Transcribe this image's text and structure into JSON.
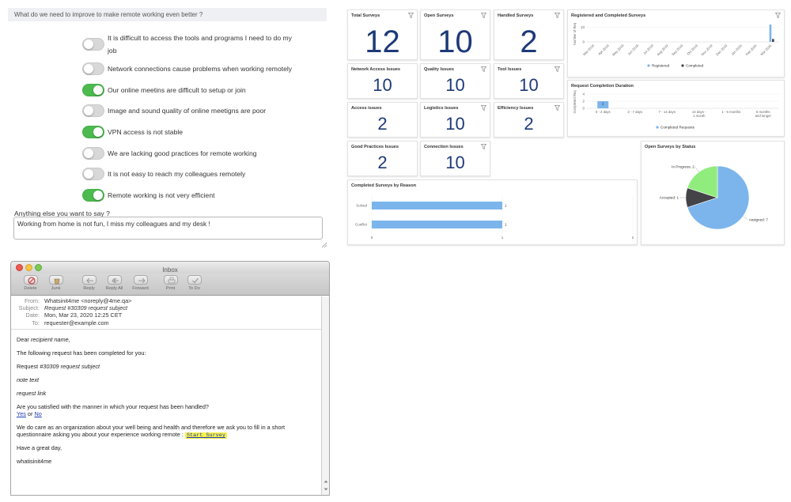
{
  "survey": {
    "question": "What do we need to improve to make remote working even better ?",
    "options": [
      {
        "label": "It is difficult to access the tools and programs I need to do my job",
        "on": false
      },
      {
        "label": "Network connections cause problems when working remotely",
        "on": false
      },
      {
        "label": "Our online meetins are difficult to setup or join",
        "on": true
      },
      {
        "label": "Image and sound quality of online meetigns are poor",
        "on": false
      },
      {
        "label": "VPN access is not stable",
        "on": true
      },
      {
        "label": "We are lacking good practices for remote working",
        "on": false
      },
      {
        "label": "It is not easy to reach my colleagues remotely",
        "on": false
      },
      {
        "label": "Remote working is not very efficient",
        "on": true
      }
    ],
    "anything_label": "Anything else you want to say ?",
    "anything_value": "Working from home is not fun, I miss my colleagues and my desk !"
  },
  "dashboard": {
    "kpis": [
      {
        "title": "Total Surveys",
        "value": "12"
      },
      {
        "title": "Open Surveys",
        "value": "10"
      },
      {
        "title": "Handled Surveys",
        "value": "2"
      },
      {
        "title": "Network Access Issues",
        "value": "10"
      },
      {
        "title": "Quality Issues",
        "value": "10"
      },
      {
        "title": "Tool Issues",
        "value": "10"
      },
      {
        "title": "Access issues",
        "value": "2"
      },
      {
        "title": "Logistics Issues",
        "value": "10"
      },
      {
        "title": "Efficiency Issues",
        "value": "2"
      },
      {
        "title": "Good Practices Issues",
        "value": "2"
      },
      {
        "title": "Connection Issues",
        "value": "10"
      }
    ],
    "colors": {
      "number": "#1d3a78",
      "bar": "#7cb5ec",
      "pie_assigned": "#7cb5ec",
      "pie_accepted": "#434348",
      "pie_inprogress": "#90ed7d"
    }
  },
  "chart_data": [
    {
      "type": "bar",
      "title": "Registered and Completed Surveys",
      "ylabel": "Number of Req",
      "categories": [
        "Mar 2019",
        "Apr 2019",
        "May 2019",
        "Jun 2019",
        "Jul 2019",
        "Aug 2019",
        "Sep 2019",
        "Oct 2019",
        "Nov 2019",
        "Dec 2019",
        "Jan 2020",
        "Feb 2020",
        "Mar 2020"
      ],
      "series": [
        {
          "name": "Registered",
          "values": [
            0,
            0,
            0,
            0,
            0,
            0,
            0,
            0,
            0,
            0,
            0,
            0,
            12
          ]
        },
        {
          "name": "Completed",
          "values": [
            0,
            0,
            0,
            0,
            0,
            0,
            0,
            0,
            0,
            0,
            0,
            0,
            2
          ]
        }
      ],
      "yticks": [
        "10",
        "0"
      ],
      "ylim": [
        0,
        12
      ],
      "legend": "bottom"
    },
    {
      "type": "bar",
      "title": "Request Completion Duration",
      "ylabel": "Completed Req",
      "categories": [
        "0 - 2 days",
        "2 - 7 days",
        "7 - 14 days",
        "14 days - 1 month",
        "1 - 6 months",
        "6 months and longer"
      ],
      "series": [
        {
          "name": "Completed Requests",
          "values": [
            2,
            0,
            0,
            0,
            0,
            0
          ]
        }
      ],
      "data_labels": [
        "2"
      ],
      "yticks": [
        "4",
        "2",
        "0"
      ],
      "ylim": [
        0,
        4
      ],
      "legend": "bottom"
    },
    {
      "type": "bar",
      "orientation": "horizontal",
      "title": "Completed Surveys by Reason",
      "categories": [
        "Solved",
        "Conflict"
      ],
      "values": [
        1,
        1
      ],
      "data_labels": [
        "1",
        "1"
      ],
      "xticks": [
        "0",
        "1",
        "2"
      ],
      "xlim": [
        0,
        2
      ]
    },
    {
      "type": "pie",
      "title": "Open Surveys by Status",
      "labels": [
        "Assigned",
        "Accepted",
        "In Progress"
      ],
      "values": [
        7,
        1,
        2
      ],
      "data_labels": [
        "Assigned: 7",
        "Accepted: 1",
        "In Progress: 2"
      ]
    }
  ],
  "mail": {
    "window_title": "Inbox",
    "toolbar": [
      {
        "label": "Delete",
        "icon": "delete-icon"
      },
      {
        "label": "Junk",
        "icon": "junk-icon"
      },
      {
        "label": "Reply",
        "icon": "reply-icon"
      },
      {
        "label": "Reply All",
        "icon": "reply-all-icon"
      },
      {
        "label": "Forward",
        "icon": "forward-icon"
      },
      {
        "label": "Print",
        "icon": "print-icon"
      },
      {
        "label": "To Do",
        "icon": "todo-icon"
      }
    ],
    "headers": {
      "from_key": "From:",
      "from_val": "Whatsinit4me <noreply@4me.qa>",
      "subject_key": "Subject:",
      "subject_val": "Request #30309 request subject",
      "date_key": "Date:",
      "date_val": "Mon, Mar 23, 2020 12:25 CET",
      "to_key": "To:",
      "to_val": "requester@example.com"
    },
    "body": {
      "greeting_prefix": "Dear ",
      "greeting_name": "recipient name,",
      "line1": "The following request has been completed for you:",
      "request_prefix": "Request ",
      "request_val": "#30309 request subject",
      "note": "note text",
      "request_link": "request link",
      "question": "Are you satisfied with the manner in which your request has been handled?",
      "yes": "Yes",
      "or": " or ",
      "no": "No",
      "care1": "We do care as an organization about your well being and health and therefore we ask you to fill in a short",
      "care2": "questionnaire asking you about your experience working remote : ",
      "start_survey": "Start Survey",
      "great_day": "Have a great day,",
      "signature": "whatisinit4me"
    }
  }
}
